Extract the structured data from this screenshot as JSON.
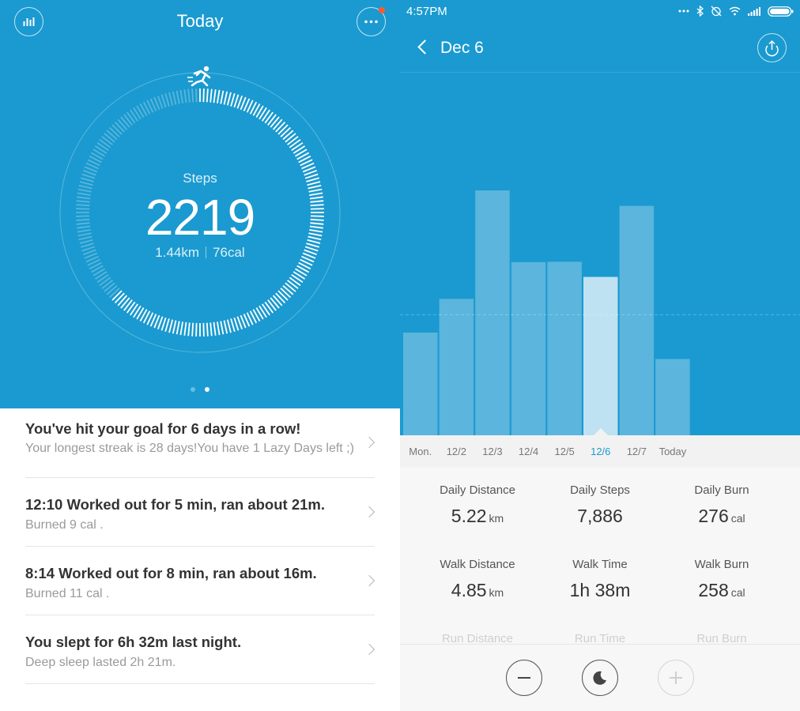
{
  "left": {
    "title": "Today",
    "steps_label": "Steps",
    "steps_value": "2219",
    "distance": "1.44km",
    "calories": "76cal",
    "goal_progress": 0.63,
    "feed": [
      {
        "title": "You've hit your goal for 6 days in a row!",
        "sub": "Your longest streak is 28 days!You have 1 Lazy Days left ;)"
      },
      {
        "title": "12:10  Worked out for 5 min, ran about 21m.",
        "sub": "Burned 9 cal ."
      },
      {
        "title": "8:14  Worked out for 8 min, ran about 16m.",
        "sub": "Burned 11 cal ."
      },
      {
        "title": "You slept for 6h 32m last night.",
        "sub": "Deep sleep lasted 2h 21m."
      }
    ]
  },
  "right": {
    "status_time": "4:57PM",
    "status_icons": [
      "more-dots-icon",
      "bluetooth-icon",
      "alarm-off-icon",
      "wifi-icon",
      "signal-icon",
      "battery-icon"
    ],
    "date_title": "Dec 6",
    "selected_index": 5,
    "chart_data": {
      "type": "bar",
      "categories": [
        "Mon.",
        "12/2",
        "12/3",
        "12/4",
        "12/5",
        "12/6",
        "12/7",
        "Today"
      ],
      "values": [
        5110,
        6790,
        12190,
        8620,
        8640,
        7886,
        11420,
        3800
      ],
      "goal": 6000,
      "selected": "12/6",
      "grid": false
    },
    "metrics": [
      {
        "label": "Daily Distance",
        "value": "5.22",
        "unit": "km"
      },
      {
        "label": "Daily Steps",
        "value": "7,886",
        "unit": ""
      },
      {
        "label": "Daily Burn",
        "value": "276",
        "unit": "cal"
      },
      {
        "label": "Walk Distance",
        "value": "4.85",
        "unit": "km"
      },
      {
        "label": "Walk Time",
        "value": "1h 38m",
        "unit": ""
      },
      {
        "label": "Walk Burn",
        "value": "258",
        "unit": "cal"
      },
      {
        "label": "Run Distance",
        "value": "",
        "unit": ""
      },
      {
        "label": "Run Time",
        "value": "",
        "unit": ""
      },
      {
        "label": "Run Burn",
        "value": "",
        "unit": ""
      }
    ]
  },
  "colors": {
    "primary": "#1a9ad0",
    "bar": "#5bb5dd",
    "bar_selected": "#bee2f1",
    "notification": "#ff5a28"
  }
}
